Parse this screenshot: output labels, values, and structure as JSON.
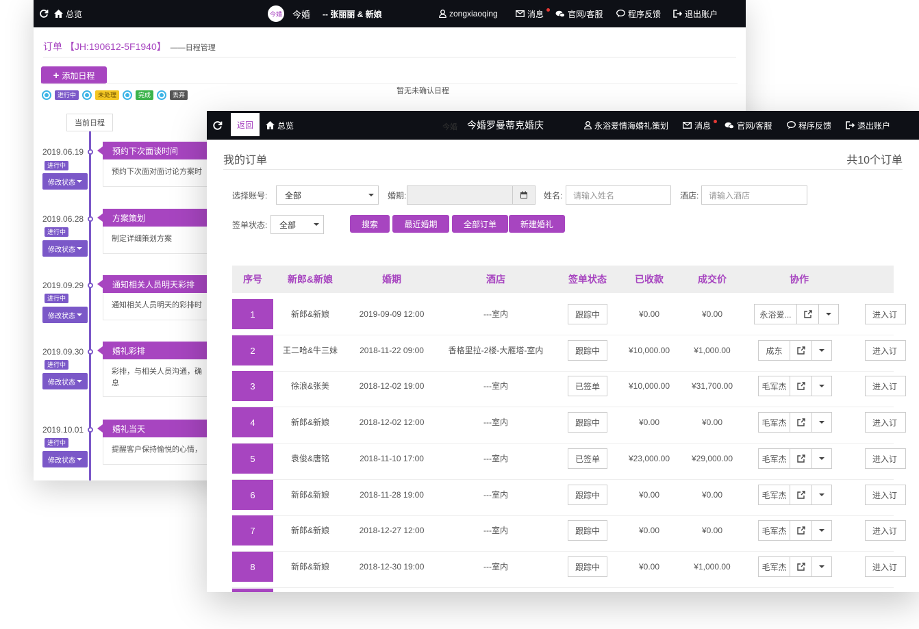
{
  "back_window": {
    "topbar": {
      "home": "总览",
      "logo": "今婚",
      "brand": "今婚",
      "couple": "-- 张丽丽 & 新娘",
      "user": "zongxiaoqing",
      "msg": "消息",
      "service": "官网/客服",
      "feedback": "程序反馈",
      "logout": "退出账户"
    },
    "title": "订单 【JH:190612-5F1940】",
    "subtitle": "——日程管理",
    "add_btn": "添加日程",
    "legend": [
      "进行中",
      "未处理",
      "完成",
      "丢弃"
    ],
    "notice": "暂无未确认日程",
    "current": "当前日程",
    "modify_label": "修改状态",
    "timeline": [
      {
        "date": "2019.06.19",
        "status": "进行中",
        "title": "预约下次面谈时间",
        "body": "预约下次面对面讨论方案时"
      },
      {
        "date": "2019.06.28",
        "status": "进行中",
        "title": "方案策划",
        "body": "制定详细策划方案"
      },
      {
        "date": "2019.09.29",
        "status": "进行中",
        "title": "通知相关人员明天彩排",
        "body": "通知相关人员明天的彩排时"
      },
      {
        "date": "2019.09.30",
        "status": "进行中",
        "title": "婚礼彩排",
        "body": "彩排，与相关人员沟通，确",
        "body2": "息"
      },
      {
        "date": "2019.10.01",
        "status": "进行中",
        "title": "婚礼当天",
        "body": "提醒客户保持愉悦的心情，"
      }
    ]
  },
  "front_window": {
    "topbar": {
      "back": "返回",
      "home": "总览",
      "logo": "今婚",
      "brand": "今婚罗曼蒂克婚庆",
      "user": "永浴爱情海婚礼策划",
      "msg": "消息",
      "service": "官网/客服",
      "feedback": "程序反馈",
      "logout": "退出账户"
    },
    "title": "我的订单",
    "count": "共10个订单",
    "filters": {
      "account_label": "选择账号:",
      "account_value": "全部",
      "date_label": "婚期:",
      "name_label": "姓名:",
      "name_placeholder": "请输入姓名",
      "hotel_label": "酒店:",
      "hotel_placeholder": "请输入酒店",
      "sign_label": "签单状态:",
      "sign_value": "全部"
    },
    "buttons": {
      "search": "搜索",
      "recent": "最近婚期",
      "all": "全部订单",
      "new": "新建婚礼"
    },
    "columns": [
      "序号",
      "新郎&新娘",
      "婚期",
      "酒店",
      "签单状态",
      "已收款",
      "成交价",
      "协作"
    ],
    "enter_label": "进入订",
    "rows": [
      {
        "idx": "1",
        "couple": "新郎&新娘",
        "date": "2019-09-09 12:00",
        "hotel": "---室内",
        "status": "跟踪中",
        "paid": "¥0.00",
        "price": "¥0.00",
        "collab": "永浴爱..."
      },
      {
        "idx": "2",
        "couple": "王二哈&牛三妹",
        "date": "2018-11-22 09:00",
        "hotel": "香格里拉-2楼-大雁塔-室内",
        "status": "跟踪中",
        "paid": "¥10,000.00",
        "price": "¥1,000.00",
        "collab": "成东"
      },
      {
        "idx": "3",
        "couple": "徐浪&张美",
        "date": "2018-12-02 19:00",
        "hotel": "---室内",
        "status": "已签单",
        "paid": "¥10,000.00",
        "price": "¥31,700.00",
        "collab": "毛军杰"
      },
      {
        "idx": "4",
        "couple": "新郎&新娘",
        "date": "2018-12-02 12:00",
        "hotel": "---室内",
        "status": "跟踪中",
        "paid": "¥0.00",
        "price": "¥0.00",
        "collab": "毛军杰"
      },
      {
        "idx": "5",
        "couple": "袁俊&唐铭",
        "date": "2018-11-10 17:00",
        "hotel": "---室内",
        "status": "已签单",
        "paid": "¥23,000.00",
        "price": "¥29,000.00",
        "collab": "毛军杰"
      },
      {
        "idx": "6",
        "couple": "新郎&新娘",
        "date": "2018-11-28 19:00",
        "hotel": "---室内",
        "status": "跟踪中",
        "paid": "¥0.00",
        "price": "¥0.00",
        "collab": "毛军杰"
      },
      {
        "idx": "7",
        "couple": "新郎&新娘",
        "date": "2018-12-27 12:00",
        "hotel": "---室内",
        "status": "跟踪中",
        "paid": "¥0.00",
        "price": "¥0.00",
        "collab": "毛军杰"
      },
      {
        "idx": "8",
        "couple": "新郎&新娘",
        "date": "2018-12-30 19:00",
        "hotel": "---室内",
        "status": "跟踪中",
        "paid": "¥0.00",
        "price": "¥1,000.00",
        "collab": "毛军杰"
      }
    ]
  },
  "colors": {
    "accent": "#a745c0",
    "timeline": "#7b58c8",
    "topbar": "#0e1016"
  }
}
